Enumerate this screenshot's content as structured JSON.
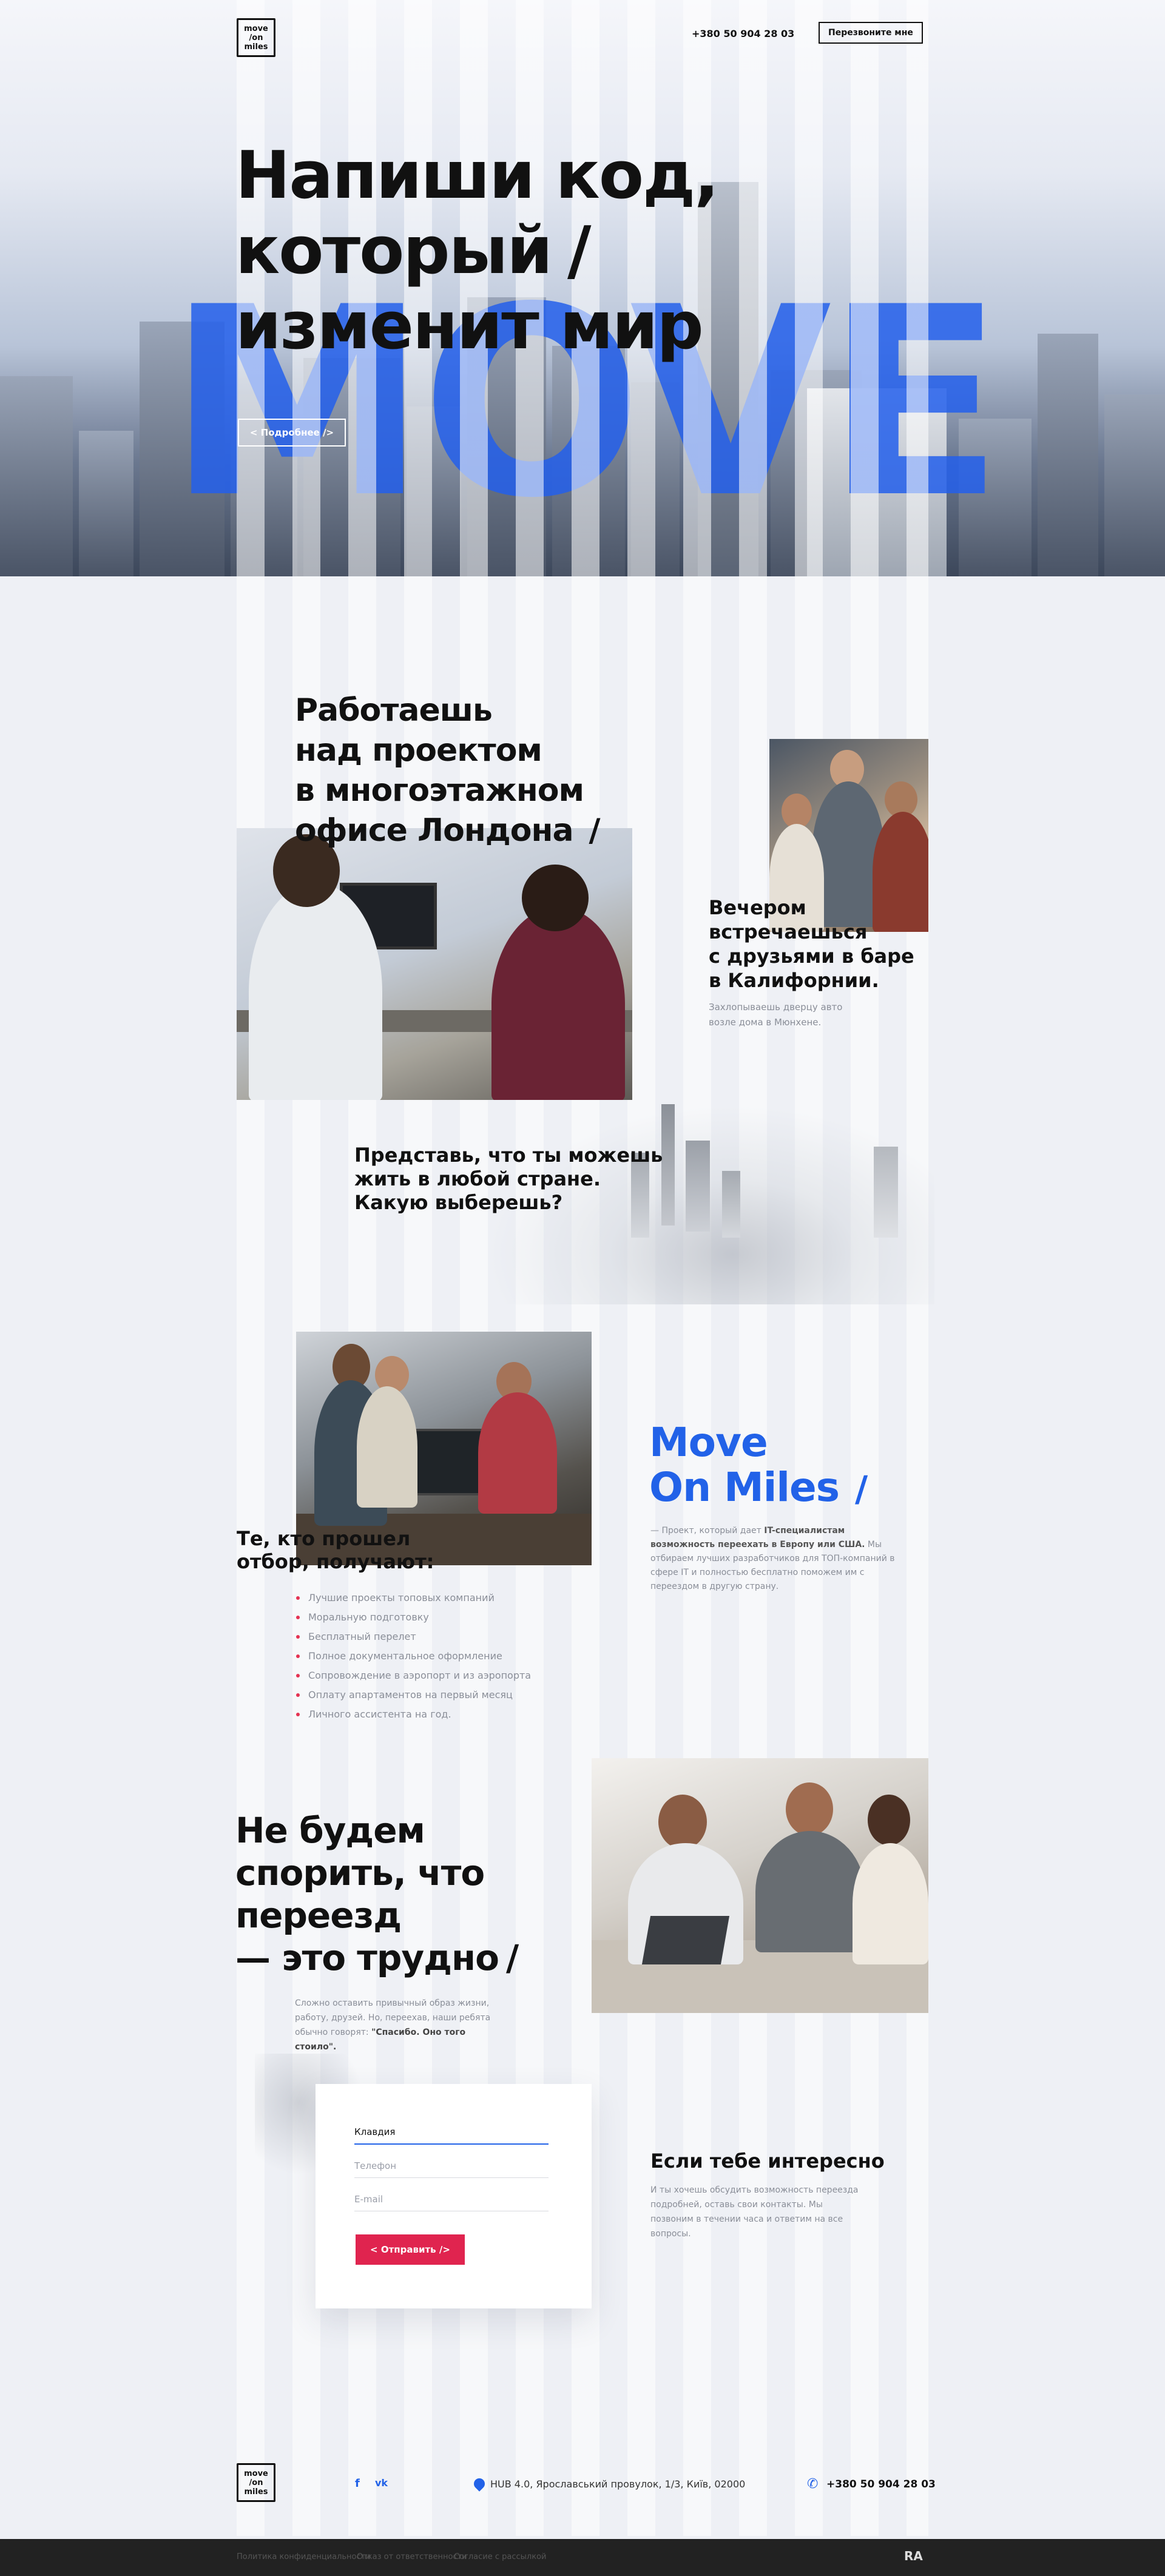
{
  "header": {
    "logo_lines": [
      "move",
      "/on",
      "miles"
    ],
    "phone": "+380 50 904 28 03",
    "call_button": "Перезвоните мне"
  },
  "hero": {
    "title_lines": [
      "Напиши код,",
      "который",
      "изменит мир"
    ],
    "slash": "/",
    "big_word": "MOVE",
    "more_button": "< Подробнее />"
  },
  "london": {
    "title_lines": [
      "Работаешь",
      "над проектом",
      "в многоэтажном",
      "офисе Лондона"
    ],
    "slash": "/"
  },
  "california": {
    "title_lines": [
      "Вечером",
      "встречаешься",
      "с друзьями в баре",
      "в Калифорнии."
    ],
    "text_lines": [
      "Захлопываешь дверцу авто",
      "возле дома в Мюнхене."
    ]
  },
  "imagine": {
    "lines": [
      "Представь, что ты можешь",
      "жить в любой стране.",
      "Какую выберешь?"
    ]
  },
  "selected": {
    "title_lines": [
      "Те, кто прошел",
      "отбор, получают:"
    ],
    "items": [
      "Лучшие проекты топовых компаний",
      "Моральную подготовку",
      "Бесплатный перелет",
      "Полное документальное оформление",
      "Сопровождение в аэропорт и из аэропорта",
      "Оплату апартаментов на первый месяц",
      "Личного ассистента на год."
    ]
  },
  "brand": {
    "line1": "Move",
    "line2": "On Miles",
    "slash": "/",
    "desc_prefix": "— Проект, который дает ",
    "desc_bold": "IT-специалистам возможность переехать в Европу или США.",
    "desc_rest": " Мы отбираем лучших разработчиков для ТОП-компаний в сфере IT и полностью бесплатно поможем им с переездом в другую страну."
  },
  "argue": {
    "title_lines": [
      "Не будем",
      "спорить, что",
      "переезд",
      "— это трудно"
    ],
    "slash": "/",
    "text": "Сложно оставить привычный образ жизни, работу, друзей. Но, переехав, наши ребята обычно говорят: ",
    "quote": "\"Спасибо. Оно того стоило\"."
  },
  "form": {
    "name_value": "Клавдия",
    "phone_placeholder": "Телефон",
    "email_placeholder": "E-mail",
    "submit": "< Отправить />"
  },
  "interest": {
    "title": "Если тебе интересно",
    "text": "И ты хочешь обсудить возможность переезда подробней, оставь свои контакты. Мы позвоним в течении часа и ответим на все вопросы."
  },
  "footer": {
    "logo_lines": [
      "move",
      "/on",
      "miles"
    ],
    "fb": "f",
    "vk": "vk",
    "address": "HUB 4.0, Ярославський провулок, 1/3, Київ, 02000",
    "phone": "+380 50 904 28 03",
    "links": [
      "Политика конфиденциальности",
      "Отказ от ответственности",
      "Согласие с рассылкой"
    ],
    "agency": "RA"
  },
  "colors": {
    "accent": "#2262e8",
    "red": "#e0244f",
    "background": "#eef0f5"
  }
}
